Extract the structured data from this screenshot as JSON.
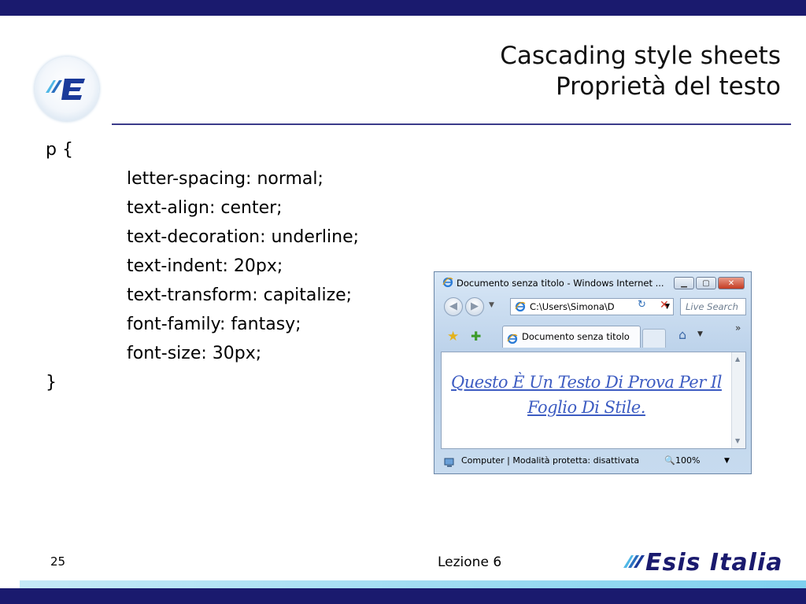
{
  "slide": {
    "title_line1": "Cascading style sheets",
    "title_line2": "Proprietà del testo",
    "code_lines": [
      "p {",
      "letter-spacing: normal;",
      "text-align: center;",
      "text-decoration: underline;",
      "text-indent: 20px;",
      "text-transform: capitalize;",
      "font-family: fantasy;",
      "font-size: 30px;",
      "}"
    ],
    "page_number": "25",
    "footer_center": "Lezione 6",
    "brand_name": "Esis Italia"
  },
  "browser": {
    "window_title": "Documento senza titolo - Windows Internet ...",
    "address": "C:\\Users\\Simona\\D",
    "search_placeholder": "Live Search",
    "tab_label": "Documento senza titolo",
    "content_text": "Questo È Un Testo Di Prova Per Il Foglio Di Stile.",
    "status_text": "Computer | Modalità protetta: disattivata",
    "zoom": "100%",
    "overflow_chevron": "»"
  },
  "colors": {
    "brand_navy": "#1a1a6e",
    "accent_cyan": "#7fd0ef",
    "link_blue": "#3d5cc2"
  },
  "icons": [
    "ie-icon",
    "back-icon",
    "forward-icon",
    "refresh-icon",
    "stop-icon",
    "favorites-star-icon",
    "add-favorite-icon",
    "home-icon",
    "computer-icon",
    "zoom-icon"
  ]
}
